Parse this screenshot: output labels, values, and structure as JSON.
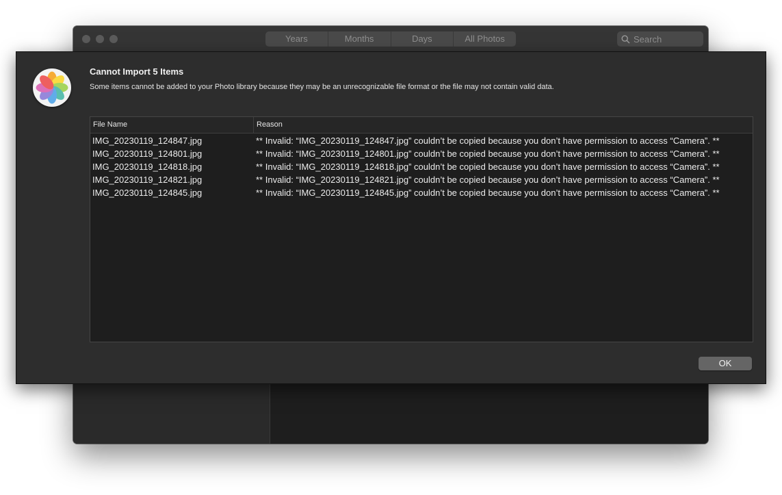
{
  "window": {
    "view_tabs": [
      "Years",
      "Months",
      "Days",
      "All Photos"
    ],
    "search": {
      "placeholder": "Search"
    }
  },
  "dialog": {
    "title": "Cannot Import 5 Items",
    "message": "Some items cannot be added to your Photo library because they may be an unrecognizable file format or the file may not contain valid data.",
    "table": {
      "columns": [
        "File Name",
        "Reason"
      ],
      "rows": [
        {
          "file": "IMG_20230119_124847.jpg",
          "reason": "** Invalid: “IMG_20230119_124847.jpg” couldn’t be copied because you don’t have permission to access “Camera”. **"
        },
        {
          "file": "IMG_20230119_124801.jpg",
          "reason": "** Invalid: “IMG_20230119_124801.jpg” couldn’t be copied because you don’t have permission to access “Camera”. **"
        },
        {
          "file": "IMG_20230119_124818.jpg",
          "reason": "** Invalid: “IMG_20230119_124818.jpg” couldn’t be copied because you don’t have permission to access “Camera”. **"
        },
        {
          "file": "IMG_20230119_124821.jpg",
          "reason": "** Invalid: “IMG_20230119_124821.jpg” couldn’t be copied because you don’t have permission to access “Camera”. **"
        },
        {
          "file": "IMG_20230119_124845.jpg",
          "reason": "** Invalid: “IMG_20230119_124845.jpg” couldn’t be copied because you don’t have permission to access “Camera”. **"
        }
      ]
    },
    "ok_label": "OK",
    "icon": "photos-app-icon"
  }
}
